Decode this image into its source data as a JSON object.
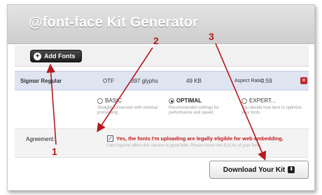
{
  "title": "@font-face Kit Generator",
  "toolbar": {
    "add_fonts_label": "Add Fonts"
  },
  "font_row": {
    "name": "Sigmar Regular",
    "type": "OTF",
    "glyphs": "397 glyphs",
    "size": "49 KB",
    "aspect_label": "Aspect Ratio:",
    "aspect_value": "0.59"
  },
  "options": [
    {
      "label": "BASIC",
      "desc": "Straight conversion with minimal processing.",
      "checked": false
    },
    {
      "label": "OPTIMAL",
      "desc": "Recommended settings for performance and speed.",
      "checked": true
    },
    {
      "label": "EXPERT...",
      "desc": "You decide how best to optimize your fonts.",
      "checked": false
    }
  ],
  "agreement": {
    "label": "Agreement:",
    "checkbox_mark": "✓",
    "text": "Yes, the fonts I'm uploading are legally eligible for web embedding.",
    "note": "Font Squirrel offers this service in good faith. Please honor the EULAs of your fonts."
  },
  "download": {
    "label": "Download Your Kit"
  },
  "annotations": {
    "one": "1",
    "two": "2",
    "three": "3"
  },
  "colors": {
    "annotation": "#b5191e",
    "row_highlight": "#dfe4f1",
    "agreement_text": "#c0171c"
  }
}
